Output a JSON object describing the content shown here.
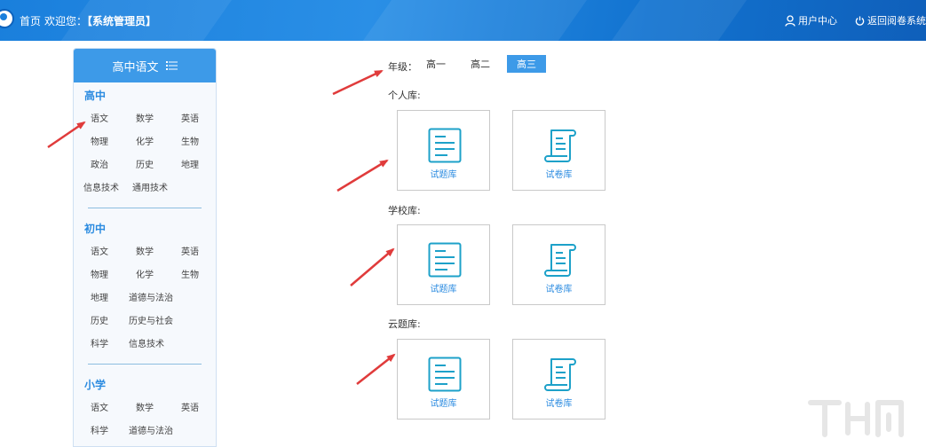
{
  "topbar": {
    "home": "首页",
    "welcome_prefix": "欢迎您：",
    "user_role": "【系统管理员】",
    "user_center": "用户中心",
    "exit": "返回阅卷系统"
  },
  "sidebar": {
    "title": "高中语文",
    "sections": [
      {
        "name": "高中",
        "subjects": [
          "语文",
          "数学",
          "英语",
          "物理",
          "化学",
          "生物",
          "政治",
          "历史",
          "地理",
          "信息技术",
          "通用技术"
        ]
      },
      {
        "name": "初中",
        "subjects": [
          "语文",
          "数学",
          "英语",
          "物理",
          "化学",
          "生物",
          "地理",
          "道德与法治",
          "历史",
          "历史与社会",
          "科学",
          "信息技术"
        ]
      },
      {
        "name": "小学",
        "subjects": [
          "语文",
          "数学",
          "英语",
          "科学",
          "道德与法治"
        ]
      }
    ]
  },
  "grade": {
    "label": "年级：",
    "options": [
      "高一",
      "高二",
      "高三"
    ],
    "selected": "高三"
  },
  "libraries": [
    {
      "title": "个人库:",
      "items": [
        "试题库",
        "试卷库"
      ]
    },
    {
      "title": "学校库:",
      "items": [
        "试题库",
        "试卷库"
      ]
    },
    {
      "title": "云题库:",
      "items": [
        "试题库",
        "试卷库"
      ]
    }
  ],
  "colors": {
    "accent": "#3d9ae8",
    "topbar": "#1a7fdc",
    "card_icon": "#1da1c9",
    "annotation_arrow": "#e03b3b"
  }
}
